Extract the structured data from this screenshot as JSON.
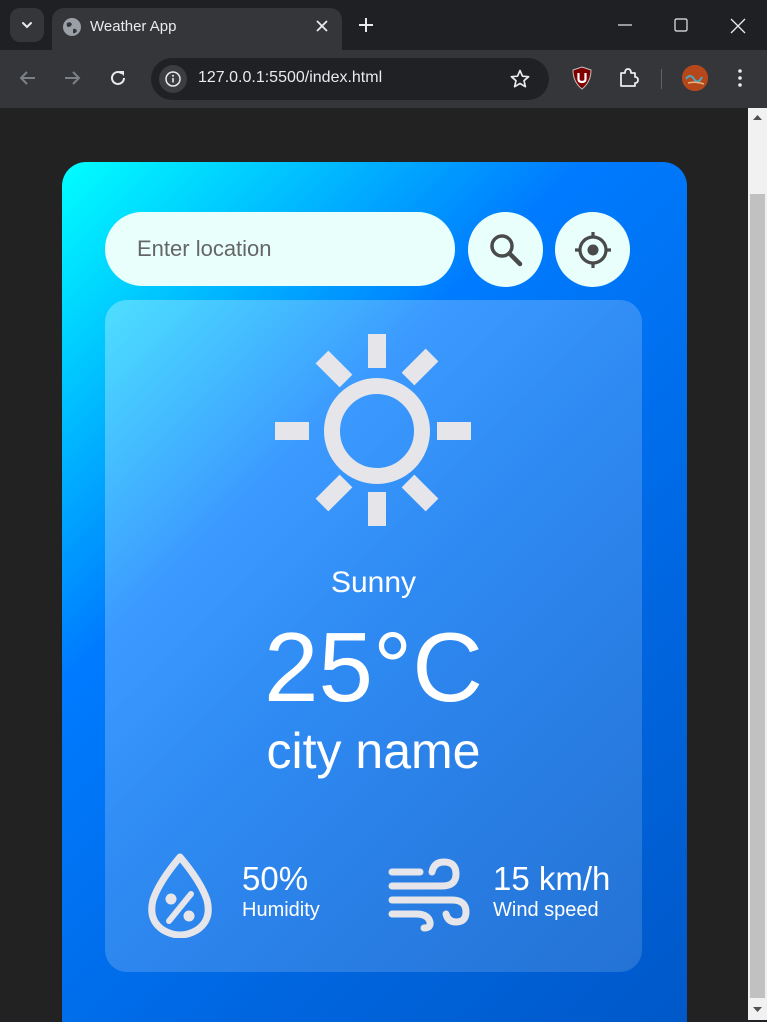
{
  "browser": {
    "tab_title": "Weather App",
    "url": "127.0.0.1:5500/index.html"
  },
  "search": {
    "placeholder": "Enter location"
  },
  "weather": {
    "condition": "Sunny",
    "temperature": "25°C",
    "city": "city name",
    "humidity_value": "50%",
    "humidity_label": "Humidity",
    "wind_value": "15 km/h",
    "wind_label": "Wind speed"
  },
  "icons": {
    "weather": "sun-icon",
    "humidity": "humidity-drop-icon",
    "wind": "wind-icon",
    "search": "search-icon",
    "locate": "crosshair-locate-icon"
  },
  "colors": {
    "card_gradient_start": "#00ffff",
    "card_gradient_end": "#0058c8",
    "input_background": "#e8fffc",
    "icon_fill": "#e5e5ea"
  }
}
